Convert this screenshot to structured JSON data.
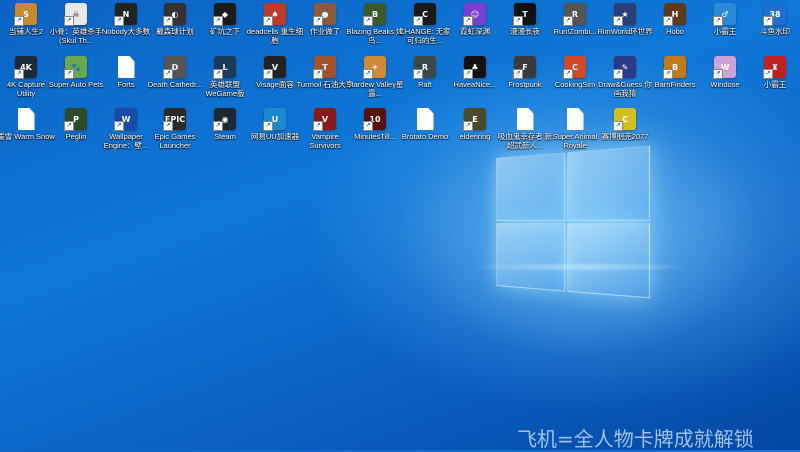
{
  "desktop": {
    "icons": [
      {
        "label": "当铺人生2",
        "color": "#c88a2a",
        "glyph": "S",
        "type": "app"
      },
      {
        "label": "小骨：英雄杀手(Skul Th...",
        "color": "#e8e8e8",
        "glyph": "☠",
        "type": "app"
      },
      {
        "label": "Nobody大多数",
        "color": "#222222",
        "glyph": "N",
        "type": "app"
      },
      {
        "label": "戴森球计划",
        "color": "#333333",
        "glyph": "◐",
        "type": "app"
      },
      {
        "label": "矿坑之下",
        "color": "#1a1a1a",
        "glyph": "◆",
        "type": "app"
      },
      {
        "label": "deadcells 重生细胞",
        "color": "#c0392b",
        "glyph": "♠",
        "type": "app"
      },
      {
        "label": "作业做了",
        "color": "#8b5a3c",
        "glyph": "●",
        "type": "app"
      },
      {
        "label": "Blazing Beaks 烽鸟...",
        "color": "#3a5a2a",
        "glyph": "B",
        "type": "app"
      },
      {
        "label": "CHANGE: 无家可归的生...",
        "color": "#1a1a1a",
        "glyph": "C",
        "type": "app"
      },
      {
        "label": "霓虹深渊",
        "color": "#7a3fd0",
        "glyph": "☺",
        "type": "app"
      },
      {
        "label": "漫漫长夜",
        "color": "#111111",
        "glyph": "T",
        "type": "app"
      },
      {
        "label": "Run!Zombi...",
        "color": "#555555",
        "glyph": "R",
        "type": "app"
      },
      {
        "label": "RimWorld环世界",
        "color": "#2a3f7a",
        "glyph": "★",
        "type": "app"
      },
      {
        "label": "Hobo",
        "color": "#5a3a1a",
        "glyph": "H",
        "type": "app"
      },
      {
        "label": "小霸王",
        "color": "#2a8ad8",
        "glyph": "♂",
        "type": "app"
      },
      {
        "label": "斗鱼水印",
        "color": "#1e6fd0",
        "glyph": "38",
        "type": "app"
      },
      {
        "label": "4K Capture Utility",
        "color": "#1a2a3a",
        "glyph": "4K",
        "type": "app"
      },
      {
        "label": "Super Auto Pets",
        "color": "#6aa84f",
        "glyph": "🐾",
        "type": "app"
      },
      {
        "label": "Forts",
        "color": "#ffffff",
        "glyph": "",
        "type": "file"
      },
      {
        "label": "Death Cathedr...",
        "color": "#555555",
        "glyph": "D",
        "type": "app"
      },
      {
        "label": "英雄联盟WeGame版",
        "color": "#1a3a5a",
        "glyph": "L",
        "type": "app"
      },
      {
        "label": "Visage面容",
        "color": "#222222",
        "glyph": "V",
        "type": "app"
      },
      {
        "label": "Turmoil 石油大亨",
        "color": "#a0522d",
        "glyph": "T",
        "type": "app"
      },
      {
        "label": "Stardew Valley星露...",
        "color": "#d08a3a",
        "glyph": "✦",
        "type": "app"
      },
      {
        "label": "Raft",
        "color": "#3a4a4a",
        "glyph": "R",
        "type": "app"
      },
      {
        "label": "HaveaNice...",
        "color": "#111111",
        "glyph": "♣",
        "type": "app"
      },
      {
        "label": "Frostpunk",
        "color": "#3a3a3a",
        "glyph": "F",
        "type": "app"
      },
      {
        "label": "CookingSim",
        "color": "#d04a2a",
        "glyph": "C",
        "type": "app"
      },
      {
        "label": "Draw&Guess 你画我猜",
        "color": "#2a3a8a",
        "glyph": "✎",
        "type": "app"
      },
      {
        "label": "BarnFinders",
        "color": "#c07a1a",
        "glyph": "B",
        "type": "app"
      },
      {
        "label": "Windose",
        "color": "#d0a0d8",
        "glyph": "W",
        "type": "app"
      },
      {
        "label": "小霸王",
        "color": "#c02020",
        "glyph": "♜",
        "type": "app"
      },
      {
        "label": "暖雪 Warm Snow",
        "color": "#ffffff",
        "glyph": "",
        "type": "file"
      },
      {
        "label": "Peglin",
        "color": "#2a4a2a",
        "glyph": "P",
        "type": "app"
      },
      {
        "label": "Wallpaper Engine：壁...",
        "color": "#1a4aa8",
        "glyph": "W",
        "type": "app"
      },
      {
        "label": "Epic Games Launcher",
        "color": "#2a2a2a",
        "glyph": "EPIC",
        "type": "app"
      },
      {
        "label": "Steam",
        "color": "#1b2838",
        "glyph": "◉",
        "type": "app"
      },
      {
        "label": "网易UU加速器",
        "color": "#1a8ad0",
        "glyph": "U",
        "type": "app"
      },
      {
        "label": "Vampire Survivors",
        "color": "#8a1a1a",
        "glyph": "V",
        "type": "app"
      },
      {
        "label": "MinutesTill...",
        "color": "#5a1010",
        "glyph": "10",
        "type": "app"
      },
      {
        "label": "Brotato Demo",
        "color": "#ffffff",
        "glyph": "",
        "type": "file"
      },
      {
        "label": "eldenring",
        "color": "#4a4a2a",
        "glyph": "E",
        "type": "app"
      },
      {
        "label": "吸血鬼幸存者 新超武新人...",
        "color": "#ffffff",
        "glyph": "",
        "type": "file"
      },
      {
        "label": "Super Animal Royale",
        "color": "#ffffff",
        "glyph": "",
        "type": "file"
      },
      {
        "label": "赛博朋克2077",
        "color": "#d0c020",
        "glyph": "C",
        "type": "app"
      }
    ]
  },
  "watermark": "飞机=全人物卡牌成就解锁"
}
